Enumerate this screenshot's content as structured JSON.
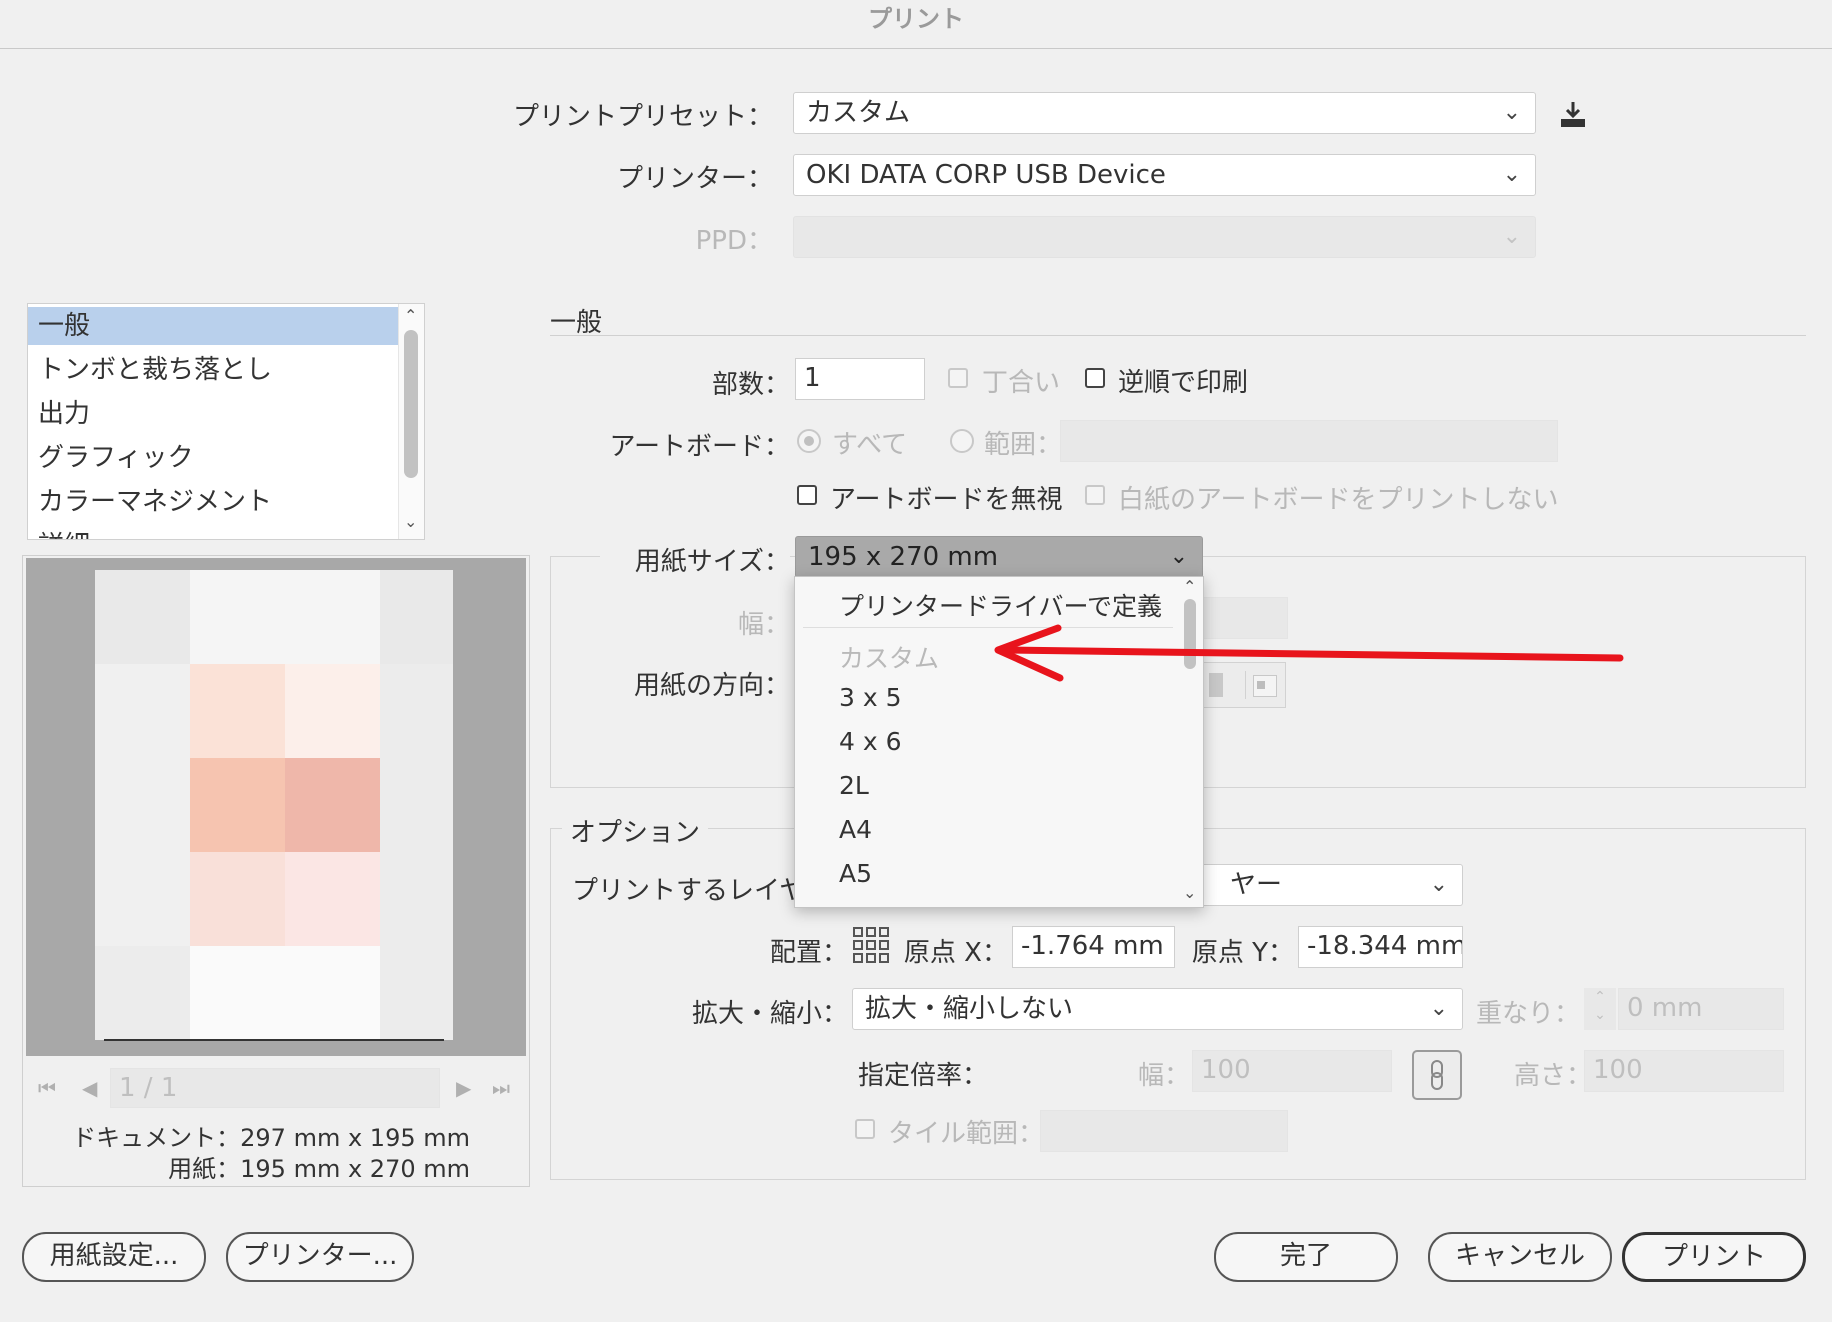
{
  "window": {
    "title": "プリント"
  },
  "preset": {
    "label": "プリントプリセット：",
    "value": "カスタム",
    "save_icon": "download-icon"
  },
  "printer": {
    "label": "プリンター：",
    "value": "OKI DATA CORP USB Device"
  },
  "ppd": {
    "label": "PPD：",
    "value": ""
  },
  "categories": {
    "items": [
      {
        "label": "一般"
      },
      {
        "label": "トンボと裁ち落とし"
      },
      {
        "label": "出力"
      },
      {
        "label": "グラフィック"
      },
      {
        "label": "カラーマネジメント"
      },
      {
        "label": "詳細"
      }
    ]
  },
  "general": {
    "heading": "一般",
    "copies_label": "部数：",
    "copies_value": "1",
    "collate_label": "丁合い",
    "reverse_label": "逆順で印刷",
    "artboard_label": "アートボード：",
    "all_label": "すべて",
    "range_label": "範囲：",
    "ignore_artboards_label": "アートボードを無視",
    "skip_blank_label": "白紙のアートボードをプリントしない"
  },
  "media": {
    "size_label": "用紙サイズ：",
    "size_value": "195 x 270 mm",
    "width_label": "幅：",
    "orientation_label": "用紙の方向："
  },
  "paper_menu": {
    "items": [
      {
        "label": "プリンタードライバーで定義"
      },
      {
        "label": "カスタム"
      },
      {
        "label": "3 x 5"
      },
      {
        "label": "4 x 6"
      },
      {
        "label": "2L"
      },
      {
        "label": "A4"
      },
      {
        "label": "A5"
      }
    ]
  },
  "options": {
    "heading": "オプション",
    "layers_label": "プリントするレイヤ",
    "layers_value_tail": "ヤー",
    "placement_label": "配置：",
    "origin_x_label": "原点 X：",
    "origin_x_value": "-1.764 mm",
    "origin_y_label": "原点 Y：",
    "origin_y_value": "-18.344 mm",
    "scaling_label": "拡大・縮小：",
    "scaling_value": "拡大・縮小しない",
    "overlap_label": "重なり：",
    "overlap_value": "0 mm",
    "custom_scale_label": "指定倍率：",
    "width_label": "幅：",
    "width_value": "100",
    "height_label": "高さ：",
    "height_value": "100",
    "tile_label": "タイル範囲："
  },
  "preview": {
    "page_value": "1 / 1",
    "document_info": "ドキュメント：297 mm x 195 mm",
    "paper_info": "用紙：195 mm x 270 mm"
  },
  "buttons": {
    "page_setup": "用紙設定...",
    "printer": "プリンター...",
    "done": "完了",
    "cancel": "キャンセル",
    "print": "プリント"
  },
  "annotation": {
    "color": "#e8141c"
  }
}
